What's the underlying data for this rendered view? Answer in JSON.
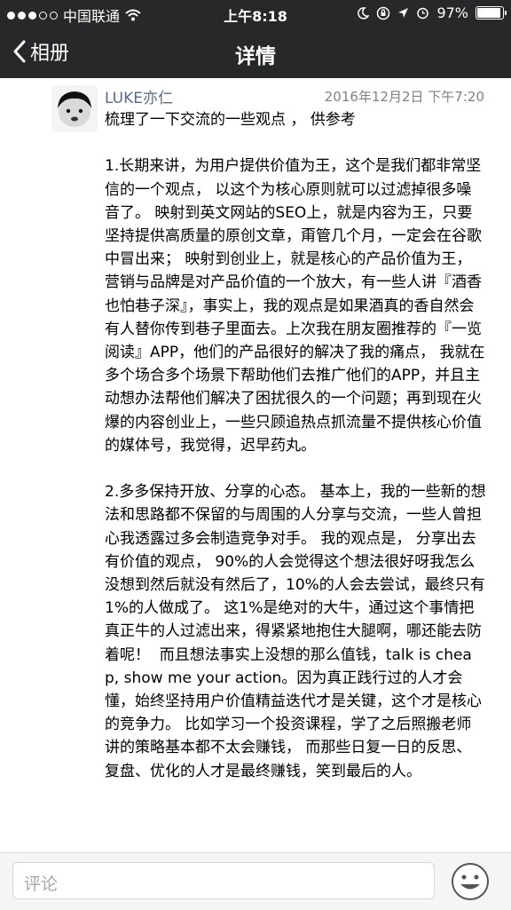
{
  "status": {
    "carrier": "中国联通",
    "time": "上午8:18",
    "battery_percent": "97%",
    "signal_icon": "signal-dots-icon",
    "wifi_icon": "wifi-icon"
  },
  "nav": {
    "back_label": "相册",
    "title": "详情"
  },
  "post": {
    "author": "LUKE亦仁",
    "timestamp": "2016年12月2日 下午7:20",
    "body": "梳理了一下交流的一些观点 ， 供参考\n\n1.长期来讲，为用户提供价值为王，这个是我们都非常坚信的一个观点， 以这个为核心原则就可以过滤掉很多噪音了。 映射到英文网站的SEO上，就是内容为王，只要坚持提供高质量的原创文章，甭管几个月，一定会在谷歌中冒出来； 映射到创业上，就是核心的产品价值为王， 营销与品牌是对产品价值的一个放大，有一些人讲『酒香也怕巷子深』，事实上，我的观点是如果酒真的香自然会有人替你传到巷子里面去。上次我在朋友圈推荐的『一览阅读』APP，他们的产品很好的解决了我的痛点， 我就在多个场合多个场景下帮助他们去推广他们的APP，并且主动想办法帮他们解决了困扰很久的一个问题；再到现在火爆的内容创业上，一些只顾追热点抓流量不提供核心价值的媒体号，我觉得，迟早药丸。\n\n2.多多保持开放、分享的心态。 基本上，我的一些新的想法和思路都不保留的与周围的人分享与交流，一些人曾担心我透露过多会制造竞争对手。 我的观点是， 分享出去有价值的观点， 90%的人会觉得这个想法很好呀我怎么没想到然后就没有然后了，10%的人会去尝试，最终只有1%的人做成了。 这1%是绝对的大牛，通过这个事情把真正牛的人过滤出来，得紧紧地抱住大腿啊，哪还能去防着呢！  而且想法事实上没想的那么值钱，talk is cheap, show me your action。因为真正践行过的人才会懂，始终坚持用户价值精益迭代才是关键，这个才是核心的竞争力。 比如学习一个投资课程，学了之后照搬老师讲的策略基本都不太会赚钱， 而那些日复一日的反思、复盘、优化的人才是最终赚钱，笑到最后的人。"
  },
  "comment": {
    "placeholder": "评论",
    "emoji_icon": "emoji-face-icon"
  },
  "colors": {
    "bar_background": "#262829",
    "author_link": "#576b95"
  }
}
